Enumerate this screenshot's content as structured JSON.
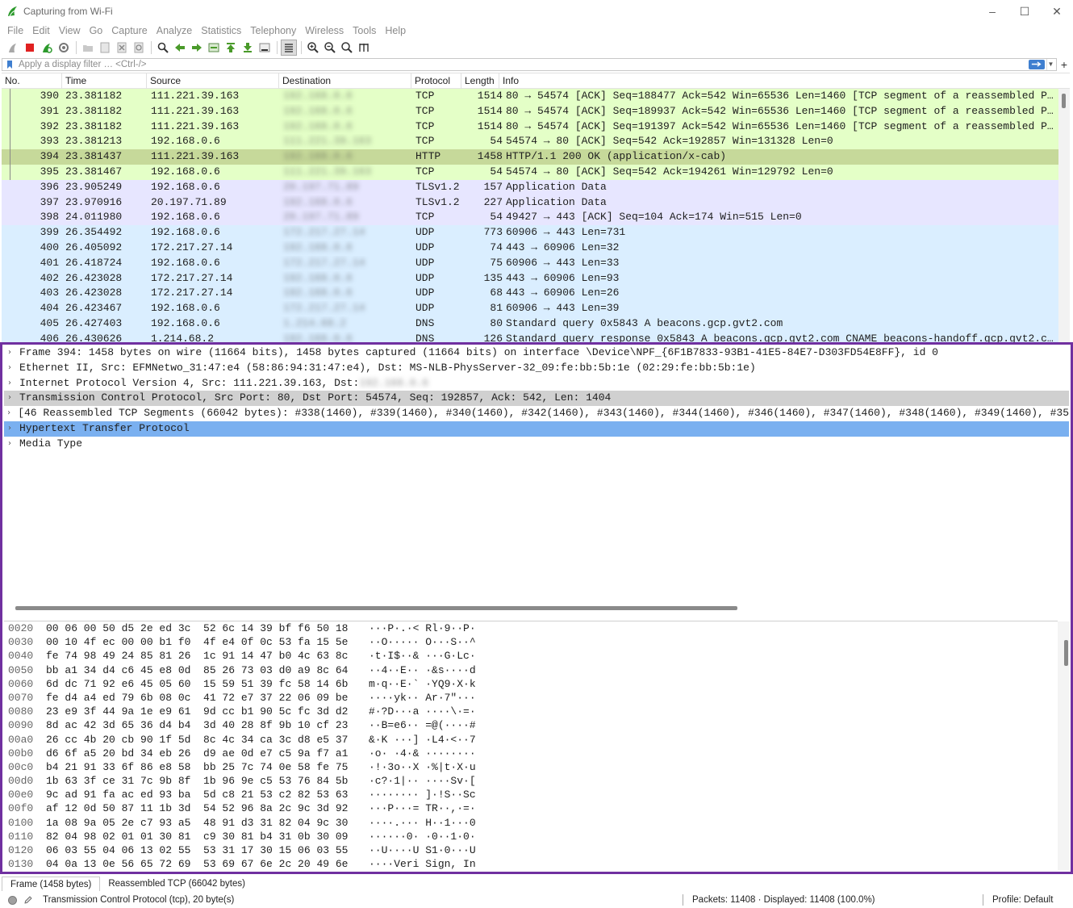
{
  "window": {
    "title": "Capturing from Wi-Fi",
    "controls": [
      "–",
      "☐",
      "✕"
    ]
  },
  "menu": [
    "File",
    "Edit",
    "View",
    "Go",
    "Capture",
    "Analyze",
    "Statistics",
    "Telephony",
    "Wireless",
    "Tools",
    "Help"
  ],
  "filter": {
    "placeholder": "Apply a display filter … <Ctrl-/>",
    "plus": "+"
  },
  "columns": {
    "no": "No.",
    "time": "Time",
    "source": "Source",
    "destination": "Destination",
    "protocol": "Protocol",
    "length": "Length",
    "info": "Info"
  },
  "colors": {
    "tcp_green": "#e4ffc7",
    "selected": "#c6d99a",
    "tls_purple": "#e7e6ff",
    "udp_blue": "#daeeff",
    "highlight_blue": "#7ab0f0",
    "tree_selected": "#d0d0d0",
    "border_purple": "#7030a0"
  },
  "packets": [
    {
      "no": "390",
      "time": "23.381182",
      "src": "111.221.39.163",
      "dst": "192.168.0.6",
      "dst_blurred": true,
      "proto": "TCP",
      "len": "1514",
      "info": "80 → 54574 [ACK] Seq=188477 Ack=542 Win=65536 Len=1460 [TCP segment of a reassembled P…",
      "color": "tcp"
    },
    {
      "no": "391",
      "time": "23.381182",
      "src": "111.221.39.163",
      "dst": "192.168.0.6",
      "dst_blurred": true,
      "proto": "TCP",
      "len": "1514",
      "info": "80 → 54574 [ACK] Seq=189937 Ack=542 Win=65536 Len=1460 [TCP segment of a reassembled P…",
      "color": "tcp"
    },
    {
      "no": "392",
      "time": "23.381182",
      "src": "111.221.39.163",
      "dst": "192.168.0.6",
      "dst_blurred": true,
      "proto": "TCP",
      "len": "1514",
      "info": "80 → 54574 [ACK] Seq=191397 Ack=542 Win=65536 Len=1460 [TCP segment of a reassembled P…",
      "color": "tcp"
    },
    {
      "no": "393",
      "time": "23.381213",
      "src": "192.168.0.6",
      "dst": "111.221.39.163",
      "dst_blurred": true,
      "proto": "TCP",
      "len": "54",
      "info": "54574 → 80 [ACK] Seq=542 Ack=192857 Win=131328 Len=0",
      "color": "tcp"
    },
    {
      "no": "394",
      "time": "23.381437",
      "src": "111.221.39.163",
      "dst": "192.168.0.6",
      "dst_blurred": true,
      "proto": "HTTP",
      "len": "1458",
      "info": "HTTP/1.1 200 OK  (application/x-cab)",
      "color": "selected"
    },
    {
      "no": "395",
      "time": "23.381467",
      "src": "192.168.0.6",
      "dst": "111.221.39.163",
      "dst_blurred": true,
      "proto": "TCP",
      "len": "54",
      "info": "54574 → 80 [ACK] Seq=542 Ack=194261 Win=129792 Len=0",
      "color": "tcp"
    },
    {
      "no": "396",
      "time": "23.905249",
      "src": "192.168.0.6",
      "dst": "20.197.71.89",
      "dst_blurred": true,
      "proto": "TLSv1.2",
      "len": "157",
      "info": "Application Data",
      "color": "tls"
    },
    {
      "no": "397",
      "time": "23.970916",
      "src": "20.197.71.89",
      "dst": "192.168.0.6",
      "dst_blurred": true,
      "proto": "TLSv1.2",
      "len": "227",
      "info": "Application Data",
      "color": "tls"
    },
    {
      "no": "398",
      "time": "24.011980",
      "src": "192.168.0.6",
      "dst": "20.197.71.89",
      "dst_blurred": true,
      "proto": "TCP",
      "len": "54",
      "info": "49427 → 443 [ACK] Seq=104 Ack=174 Win=515 Len=0",
      "color": "tls"
    },
    {
      "no": "399",
      "time": "26.354492",
      "src": "192.168.0.6",
      "dst": "172.217.27.14",
      "dst_blurred": true,
      "proto": "UDP",
      "len": "773",
      "info": "60906 → 443 Len=731",
      "color": "udp"
    },
    {
      "no": "400",
      "time": "26.405092",
      "src": "172.217.27.14",
      "dst": "192.168.0.6",
      "dst_blurred": true,
      "proto": "UDP",
      "len": "74",
      "info": "443 → 60906 Len=32",
      "color": "udp"
    },
    {
      "no": "401",
      "time": "26.418724",
      "src": "192.168.0.6",
      "dst": "172.217.27.14",
      "dst_blurred": true,
      "proto": "UDP",
      "len": "75",
      "info": "60906 → 443 Len=33",
      "color": "udp"
    },
    {
      "no": "402",
      "time": "26.423028",
      "src": "172.217.27.14",
      "dst": "192.168.0.6",
      "dst_blurred": true,
      "proto": "UDP",
      "len": "135",
      "info": "443 → 60906 Len=93",
      "color": "udp"
    },
    {
      "no": "403",
      "time": "26.423028",
      "src": "172.217.27.14",
      "dst": "192.168.0.6",
      "dst_blurred": true,
      "proto": "UDP",
      "len": "68",
      "info": "443 → 60906 Len=26",
      "color": "udp"
    },
    {
      "no": "404",
      "time": "26.423467",
      "src": "192.168.0.6",
      "dst": "172.217.27.14",
      "dst_blurred": true,
      "proto": "UDP",
      "len": "81",
      "info": "60906 → 443 Len=39",
      "color": "udp"
    },
    {
      "no": "405",
      "time": "26.427403",
      "src": "192.168.0.6",
      "dst": "1.214.68.2",
      "dst_blurred": true,
      "proto": "DNS",
      "len": "80",
      "info": "Standard query 0x5843 A beacons.gcp.gvt2.com",
      "color": "udp"
    },
    {
      "no": "406",
      "time": "26.430626",
      "src": "1.214.68.2",
      "dst": "192.168.0.6",
      "dst_blurred": true,
      "proto": "DNS",
      "len": "126",
      "info": "Standard query response 0x5843 A beacons.gcp.gvt2.com CNAME beacons-handoff.gcp.gvt2.c…",
      "color": "udp"
    }
  ],
  "details": [
    {
      "text": "Frame 394: 1458 bytes on wire (11664 bits), 1458 bytes captured (11664 bits) on interface \\Device\\NPF_{6F1B7833-93B1-41E5-84E7-D303FD54E8FF}, id 0",
      "state": "normal"
    },
    {
      "text": "Ethernet II, Src: EFMNetwo_31:47:e4 (58:86:94:31:47:e4), Dst: MS-NLB-PhysServer-32_09:fe:bb:5b:1e (02:29:fe:bb:5b:1e)",
      "state": "normal"
    },
    {
      "text": "Internet Protocol Version 4, Src: 111.221.39.163, Dst: ",
      "blurred_suffix": "192.168.0.6",
      "state": "normal"
    },
    {
      "text": "Transmission Control Protocol, Src Port: 80, Dst Port: 54574, Seq: 192857, Ack: 542, Len: 1404",
      "state": "gray"
    },
    {
      "text": "[46 Reassembled TCP Segments (66042 bytes): #338(1460), #339(1460), #340(1460), #342(1460), #343(1460), #344(1460), #346(1460), #347(1460), #348(1460), #349(1460), #35",
      "state": "normal"
    },
    {
      "text": "Hypertext Transfer Protocol",
      "state": "blue"
    },
    {
      "text": "Media Type",
      "state": "normal"
    }
  ],
  "bytes": [
    {
      "off": "0020",
      "hex": "00 06 00 50 d5 2e ed 3c  52 6c 14 39 bf f6 50 18",
      "ascii": "···P·.·< Rl·9··P·"
    },
    {
      "off": "0030",
      "hex": "00 10 4f ec 00 00 b1 f0  4f e4 0f 0c 53 fa 15 5e",
      "ascii": "··O····· O···S··^"
    },
    {
      "off": "0040",
      "hex": "fe 74 98 49 24 85 81 26  1c 91 14 47 b0 4c 63 8c",
      "ascii": "·t·I$··& ···G·Lc·"
    },
    {
      "off": "0050",
      "hex": "bb a1 34 d4 c6 45 e8 0d  85 26 73 03 d0 a9 8c 64",
      "ascii": "··4··E·· ·&s····d"
    },
    {
      "off": "0060",
      "hex": "6d dc 71 92 e6 45 05 60  15 59 51 39 fc 58 14 6b",
      "ascii": "m·q··E·` ·YQ9·X·k"
    },
    {
      "off": "0070",
      "hex": "fe d4 a4 ed 79 6b 08 0c  41 72 e7 37 22 06 09 be",
      "ascii": "····yk·· Ar·7\"···"
    },
    {
      "off": "0080",
      "hex": "23 e9 3f 44 9a 1e e9 61  9d cc b1 90 5c fc 3d d2",
      "ascii": "#·?D···a ····\\·=·"
    },
    {
      "off": "0090",
      "hex": "8d ac 42 3d 65 36 d4 b4  3d 40 28 8f 9b 10 cf 23",
      "ascii": "··B=e6·· =@(····#"
    },
    {
      "off": "00a0",
      "hex": "26 cc 4b 20 cb 90 1f 5d  8c 4c 34 ca 3c d8 e5 37",
      "ascii": "&·K ···] ·L4·<··7"
    },
    {
      "off": "00b0",
      "hex": "d6 6f a5 20 bd 34 eb 26  d9 ae 0d e7 c5 9a f7 a1",
      "ascii": "·o· ·4·& ········"
    },
    {
      "off": "00c0",
      "hex": "b4 21 91 33 6f 86 e8 58  bb 25 7c 74 0e 58 fe 75",
      "ascii": "·!·3o··X ·%|t·X·u"
    },
    {
      "off": "00d0",
      "hex": "1b 63 3f ce 31 7c 9b 8f  1b 96 9e c5 53 76 84 5b",
      "ascii": "·c?·1|·· ····Sv·["
    },
    {
      "off": "00e0",
      "hex": "9c ad 91 fa ac ed 93 ba  5d c8 21 53 c2 82 53 63",
      "ascii": "········ ]·!S··Sc"
    },
    {
      "off": "00f0",
      "hex": "af 12 0d 50 87 11 1b 3d  54 52 96 8a 2c 9c 3d 92",
      "ascii": "···P···= TR··,·=·"
    },
    {
      "off": "0100",
      "hex": "1a 08 9a 05 2e c7 93 a5  48 91 d3 31 82 04 9c 30",
      "ascii": "····.··· H··1···0"
    },
    {
      "off": "0110",
      "hex": "82 04 98 02 01 01 30 81  c9 30 81 b4 31 0b 30 09",
      "ascii": "······0· ·0··1·0·"
    },
    {
      "off": "0120",
      "hex": "06 03 55 04 06 13 02 55  53 31 17 30 15 06 03 55",
      "ascii": "··U····U S1·0···U"
    },
    {
      "off": "0130",
      "hex": "04 0a 13 0e 56 65 72 69  53 69 67 6e 2c 20 49 6e",
      "ascii": "····Veri Sign, In"
    }
  ],
  "tabs": [
    "Frame (1458 bytes)",
    "Reassembled TCP (66042 bytes)"
  ],
  "status": {
    "field": "Transmission Control Protocol (tcp), 20 byte(s)",
    "packets": "Packets: 11408 · Displayed: 11408 (100.0%)",
    "profile": "Profile: Default"
  }
}
